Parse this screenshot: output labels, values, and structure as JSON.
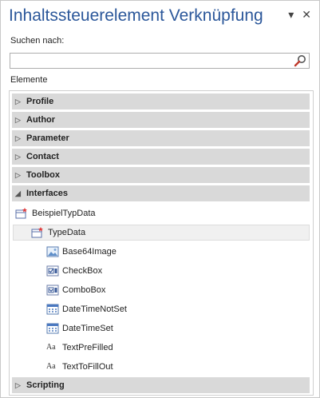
{
  "pane": {
    "title": "Inhaltssteuerelement Verknüpfung",
    "menu_glyph": "▾",
    "close_glyph": "✕"
  },
  "search": {
    "label": "Suchen nach:",
    "value": "",
    "placeholder": ""
  },
  "elements_label": "Elemente",
  "groups": [
    {
      "label": "Profile",
      "expanded": false
    },
    {
      "label": "Author",
      "expanded": false
    },
    {
      "label": "Parameter",
      "expanded": false
    },
    {
      "label": "Contact",
      "expanded": false
    },
    {
      "label": "Toolbox",
      "expanded": false
    },
    {
      "label": "Interfaces",
      "expanded": true
    },
    {
      "label": "Scripting",
      "expanded": false
    }
  ],
  "interfaces_tree": {
    "root": {
      "label": "BeispielTypData",
      "icon": "class-icon"
    },
    "child": {
      "label": "TypeData",
      "icon": "class-icon",
      "selected": true
    },
    "items": [
      {
        "label": "Base64Image",
        "icon": "image-icon"
      },
      {
        "label": "CheckBox",
        "icon": "checkbox-control-icon"
      },
      {
        "label": "ComboBox",
        "icon": "combobox-control-icon"
      },
      {
        "label": "DateTimeNotSet",
        "icon": "calendar-icon"
      },
      {
        "label": "DateTimeSet",
        "icon": "calendar-icon"
      },
      {
        "label": "TextPreFilled",
        "icon": "text-icon"
      },
      {
        "label": "TextToFillOut",
        "icon": "text-icon"
      }
    ]
  },
  "text_icon_glyph": "Aa",
  "colors": {
    "title": "#2b579a",
    "group_bg": "#d9d9d9",
    "accent_red": "#e03a3a"
  }
}
